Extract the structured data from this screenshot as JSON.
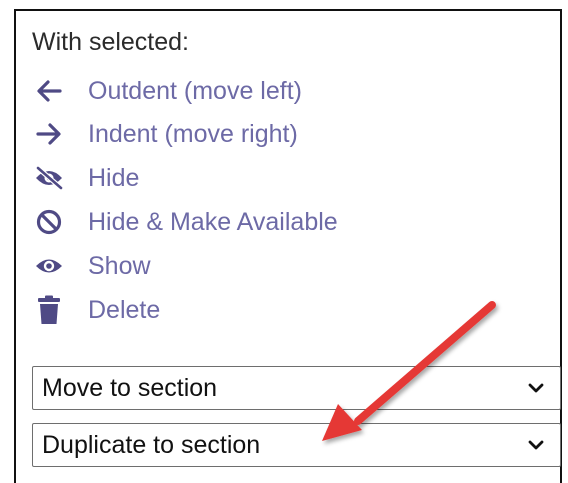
{
  "panel": {
    "heading": "With selected:",
    "actions": [
      {
        "label": "Outdent (move left)",
        "icon": "arrow-left-icon"
      },
      {
        "label": "Indent (move right)",
        "icon": "arrow-right-icon"
      },
      {
        "label": "Hide",
        "icon": "eye-slash-icon"
      },
      {
        "label": "Hide & Make Available",
        "icon": "ban-icon"
      },
      {
        "label": "Show",
        "icon": "eye-icon"
      },
      {
        "label": "Delete",
        "icon": "trash-icon"
      }
    ],
    "move_select": {
      "value": "Move to section",
      "icon": "chevron-down-icon"
    },
    "duplicate_select": {
      "value": "Duplicate to section",
      "icon": "chevron-down-icon"
    }
  },
  "annotation": {
    "icon": "red-arrow-icon",
    "color": "#e53935"
  },
  "colors": {
    "action_text": "#6d6aa6",
    "icon": "#4f4a85",
    "heading_text": "#2b2b2b",
    "border": "#111111"
  }
}
